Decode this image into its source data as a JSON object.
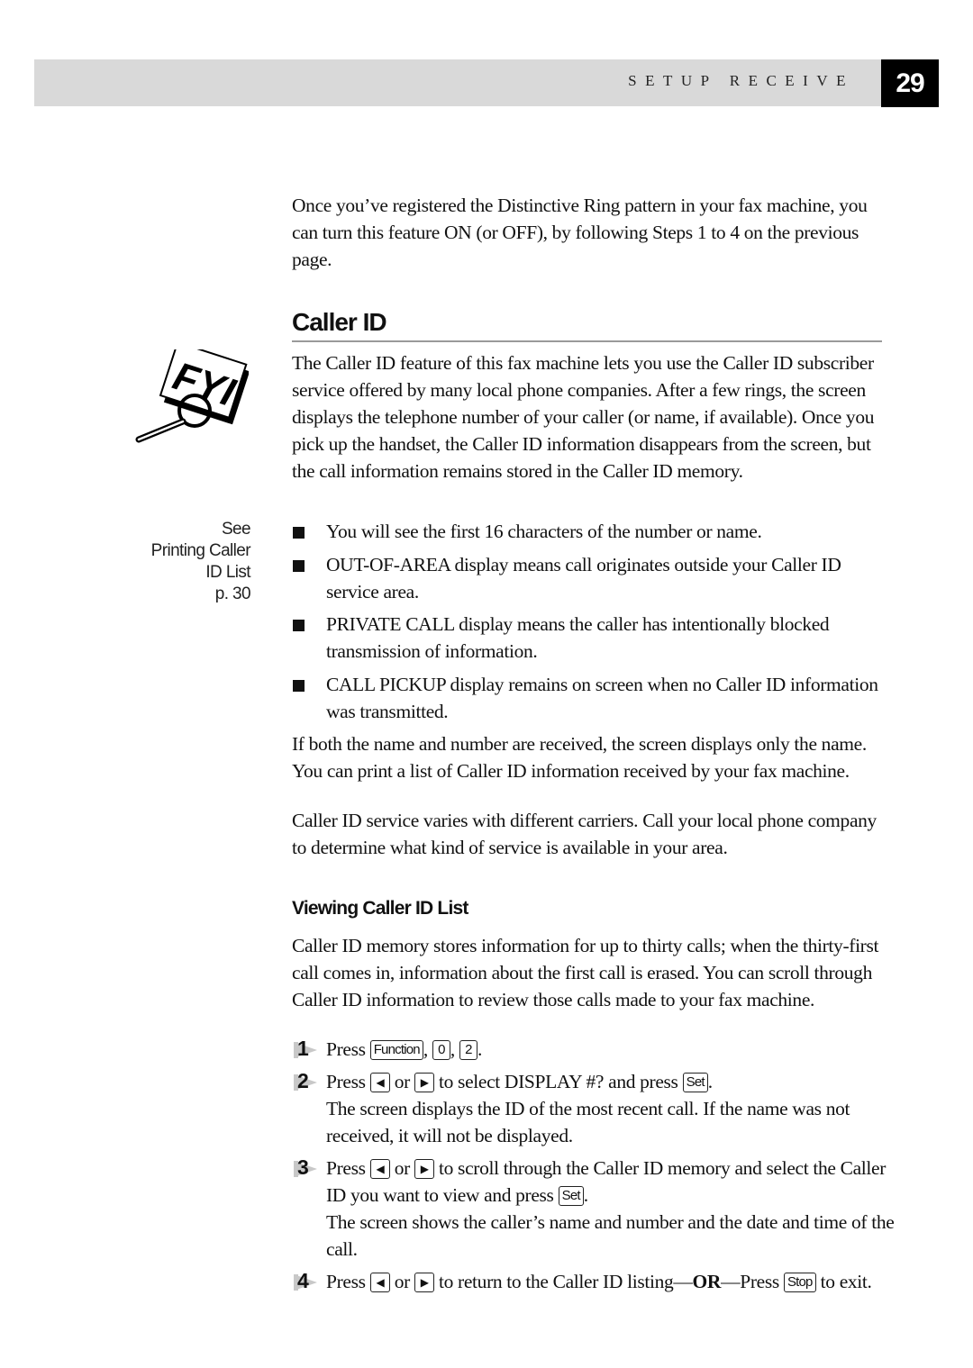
{
  "header": {
    "running_head": "SETUP RECEIVE",
    "page_number": "29"
  },
  "intro": "Once you’ve registered the Distinctive Ring pattern in your fax machine, you can turn this feature ON (or OFF), by following Steps 1 to 4 on the previous page.",
  "section": {
    "title": "Caller ID",
    "paragraph": "The Caller ID feature of this fax machine lets you use the Caller ID subscriber service offered by many local phone companies. After a few rings, the screen displays the telephone number of your caller (or name, if available).  Once you pick up the  handset, the Caller ID information disappears from the screen, but the call information remains stored in the Caller ID memory.",
    "bullets": [
      "You will see the first 16 characters of the number or name.",
      "OUT-OF-AREA display means call originates outside your Caller ID service area.",
      "PRIVATE CALL display means the caller has intentionally blocked transmission of information.",
      "CALL PICKUP display remains on screen when no Caller ID information was transmitted."
    ],
    "paragraph2": "If both the name and number are received, the screen displays only the name. You can print a list of Caller ID information received by your fax machine.",
    "paragraph3": "Caller ID service varies with different carriers.  Call your local phone company to determine what kind of service is available in your area."
  },
  "sidenote": {
    "icon": "fyi-magnifier-icon",
    "lines": [
      "See",
      "Printing Caller",
      "ID List",
      "p. 30"
    ]
  },
  "subsection": {
    "title": "Viewing Caller ID List",
    "paragraph": "Caller ID memory stores information for up to thirty calls; when the thirty-first call comes in, information about the first call is erased.  You can scroll through Caller ID information to review those calls made to your fax machine."
  },
  "keys": {
    "function": "Function",
    "zero": "0",
    "two": "2",
    "left": "◀",
    "right": "▶",
    "set": "Set",
    "stop": "Stop"
  },
  "steps": [
    {
      "number": "1",
      "press": "Press",
      "sep1": ",",
      "sep2": ",",
      "end": "."
    },
    {
      "number": "2",
      "press": "Press",
      "or": "or",
      "text": "to select DISPLAY #? and press",
      "end": ".",
      "note": "The screen displays the ID of the most recent call. If the name was not received, it will not be displayed."
    },
    {
      "number": "3",
      "press": "Press",
      "or": "or",
      "text": "to scroll through the Caller ID memory and select the Caller ID you want to view and press",
      "end": ".",
      "note": "The screen shows the caller’s name and number and the date and time of the call."
    },
    {
      "number": "4",
      "press": "Press",
      "or": "or",
      "text": "to return to the Caller ID listing",
      "dash1": "—",
      "or_bold": "OR",
      "dash2": "—Press",
      "end": "to exit."
    }
  ]
}
